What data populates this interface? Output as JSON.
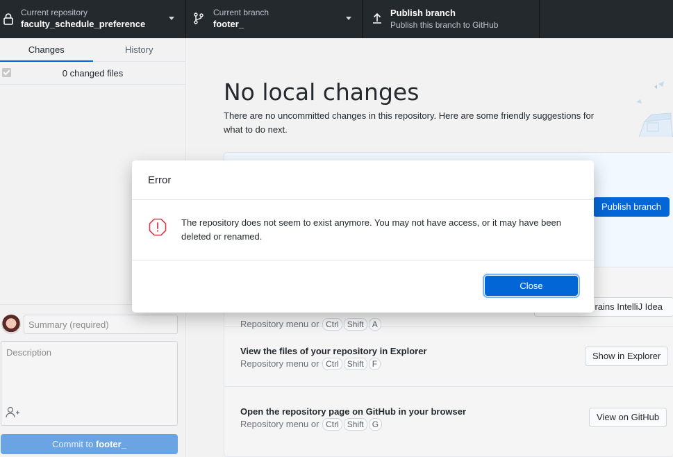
{
  "toolbar": {
    "repo_label": "Current repository",
    "repo_value": "faculty_schedule_preference",
    "branch_label": "Current branch",
    "branch_value": "footer_",
    "publish_label": "Publish branch",
    "publish_sub": "Publish this branch to GitHub"
  },
  "sidebar": {
    "tabs": [
      "Changes",
      "History"
    ],
    "changed_files": "0 changed files",
    "summary_placeholder": "Summary (required)",
    "description_placeholder": "Description",
    "commit_prefix": "Commit to ",
    "commit_branch": "footer_"
  },
  "main": {
    "title": "No local changes",
    "subtitle": "There are no uncommitted changes in this repository. Here are some friendly suggestions for what to do next.",
    "publish_button": "Publish branch",
    "suggestions": [
      {
        "title": "",
        "hint_prefix": "Repository menu or",
        "keys": [
          "Ctrl",
          "Shift",
          "A"
        ],
        "button": "Open in JetBrains IntelliJ Idea",
        "button_visible": "rains IntelliJ Idea"
      },
      {
        "title": "View the files of your repository in Explorer",
        "hint_prefix": "Repository menu or",
        "keys": [
          "Ctrl",
          "Shift",
          "F"
        ],
        "button": "Show in Explorer"
      },
      {
        "title": "Open the repository page on GitHub in your browser",
        "hint_prefix": "Repository menu or",
        "keys": [
          "Ctrl",
          "Shift",
          "G"
        ],
        "button": "View on GitHub"
      }
    ]
  },
  "dialog": {
    "title": "Error",
    "message": "The repository does not seem to exist anymore. You may not have access, or it may have been deleted or renamed.",
    "close_button": "Close"
  },
  "colors": {
    "accent": "#0366d6",
    "toolbar_bg": "#24292e",
    "error": "#d73a49"
  },
  "icons": [
    "lock-icon",
    "caret-down-icon",
    "git-branch-icon",
    "upload-icon",
    "error-icon",
    "add-coauthor-icon"
  ]
}
